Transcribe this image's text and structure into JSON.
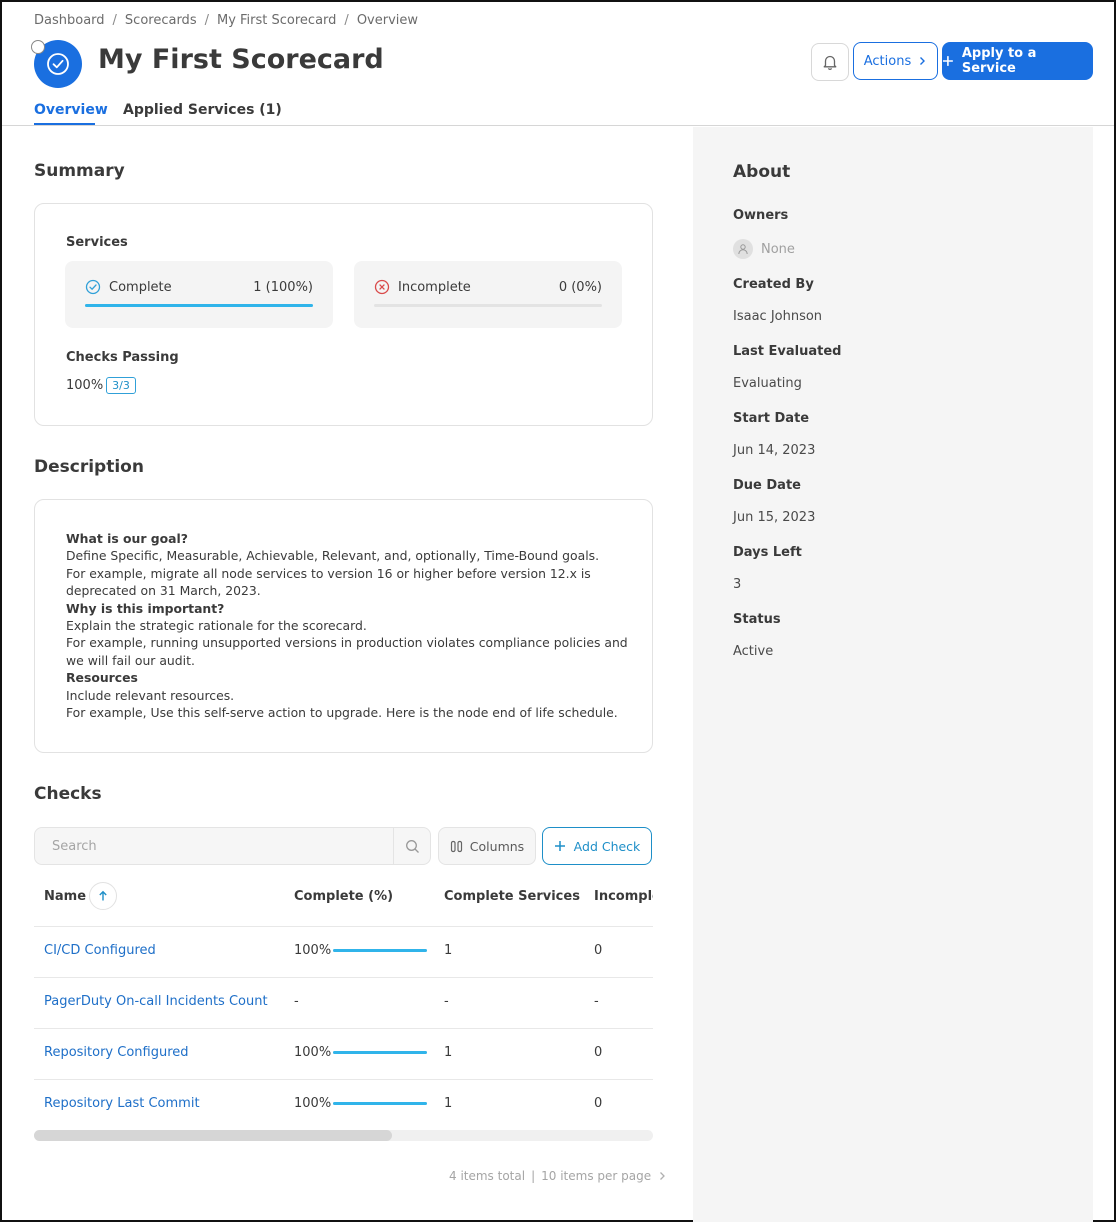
{
  "breadcrumb": [
    "Dashboard",
    "Scorecards",
    "My First Scorecard",
    "Overview"
  ],
  "header": {
    "title": "My First Scorecard",
    "actions_label": "Actions",
    "apply_label": "Apply to a Service",
    "accent_color": "#1a6fe0"
  },
  "tabs": [
    {
      "label": "Overview",
      "active": true
    },
    {
      "label": "Applied Services (1)",
      "active": false
    }
  ],
  "summary": {
    "title": "Summary",
    "services_label": "Services",
    "complete": {
      "label": "Complete",
      "value": "1 (100%)",
      "fraction": 1.0
    },
    "incomplete": {
      "label": "Incomplete",
      "value": "0 (0%)",
      "fraction": 0.0
    },
    "checks_passing_label": "Checks Passing",
    "checks_passing_pct": "100%",
    "checks_passing_badge": "3/3"
  },
  "description": {
    "title": "Description",
    "goal_heading": "What is our goal?",
    "goal_line1": "Define Specific, Measurable, Achievable, Relevant, and, optionally, Time-Bound goals.",
    "goal_line2": "For example, migrate all node services to version 16 or higher before version 12.x is deprecated on 31 March, 2023.",
    "why_heading": "Why is this important?",
    "why_line1": "Explain the strategic rationale for the scorecard.",
    "why_line2": "For example, running unsupported versions in production violates compliance policies and we will fail our audit.",
    "resources_heading": "Resources",
    "resources_line1": "Include relevant resources.",
    "resources_line2": "For example, Use this self-serve action to upgrade. Here is the node end of life schedule."
  },
  "checks": {
    "title": "Checks",
    "search_placeholder": "Search",
    "columns_label": "Columns",
    "add_check_label": "Add Check",
    "headers": {
      "name": "Name",
      "complete": "Complete (%)",
      "complete_services": "Complete Services",
      "incomplete_services": "Incomplete Services"
    },
    "rows": [
      {
        "name": "CI/CD Configured",
        "pct": "100%",
        "fraction": 1.0,
        "complete": "1",
        "incomplete": "0"
      },
      {
        "name": "PagerDuty On-call Incidents Count",
        "pct": "-",
        "fraction": null,
        "complete": "-",
        "incomplete": "-"
      },
      {
        "name": "Repository Configured",
        "pct": "100%",
        "fraction": 1.0,
        "complete": "1",
        "incomplete": "0"
      },
      {
        "name": "Repository Last Commit",
        "pct": "100%",
        "fraction": 1.0,
        "complete": "1",
        "incomplete": "0"
      }
    ],
    "pager": {
      "total": "4 items total",
      "per_page": "10 items per page"
    }
  },
  "about": {
    "title": "About",
    "owners_label": "Owners",
    "owners_value": "None",
    "created_by_label": "Created By",
    "created_by_value": "Isaac Johnson",
    "last_evaluated_label": "Last Evaluated",
    "last_evaluated_value": "Evaluating",
    "start_date_label": "Start Date",
    "start_date_value": "Jun 14, 2023",
    "due_date_label": "Due Date",
    "due_date_value": "Jun 15, 2023",
    "days_left_label": "Days Left",
    "days_left_value": "3",
    "status_label": "Status",
    "status_value": "Active"
  }
}
